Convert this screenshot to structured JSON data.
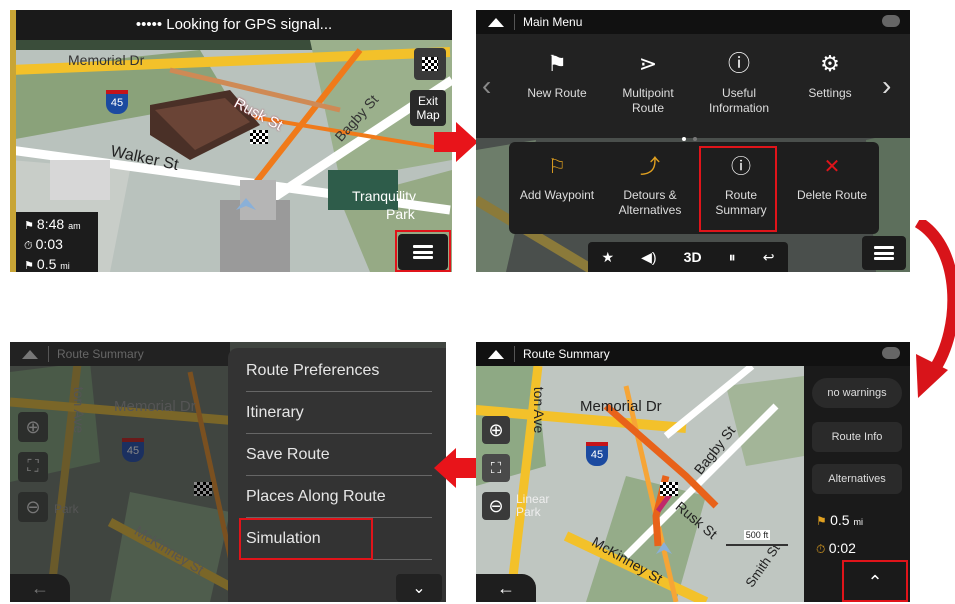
{
  "panel1": {
    "gps_status": "••••• Looking for GPS signal...",
    "street_labels": {
      "memorial": "Memorial Dr",
      "interstate": "45",
      "rusk": "Rusk St",
      "bagby": "Bagby St",
      "walker": "Walker St",
      "tranquility": "Tranquility",
      "park": "Park"
    },
    "exit_map": [
      "Exit",
      "Map"
    ],
    "stats": {
      "eta": "8:48",
      "eta_unit": "am",
      "time": "0:03",
      "distance": "0.5",
      "distance_unit": "mi"
    }
  },
  "panel2": {
    "title": "Main Menu",
    "menu_items": [
      {
        "icon": "checkered-flag",
        "label": "New Route"
      },
      {
        "icon": "multipoint",
        "label": "Multipoint\nRoute"
      },
      {
        "icon": "info",
        "label": "Useful\nInformation"
      },
      {
        "icon": "gear",
        "label": "Settings"
      }
    ],
    "sub_items": [
      {
        "icon": "waypoint-flag",
        "label": "Add Waypoint"
      },
      {
        "icon": "detour",
        "label": "Detours &\nAlternatives"
      },
      {
        "icon": "route-summary",
        "label": "Route\nSummary"
      },
      {
        "icon": "delete-route",
        "label": "Delete Route"
      }
    ],
    "bottom_bar": {
      "mode_3d": "3D"
    }
  },
  "panel3": {
    "title": "Route Summary",
    "map_labels": {
      "memorial": "Memorial Dr",
      "ave": "ton Ave",
      "interstate": "45",
      "mckinney": "McKinney St",
      "park": "Park"
    },
    "menu_items": [
      "Route Preferences",
      "Itinerary",
      "Save Route",
      "Places Along Route",
      "Simulation"
    ]
  },
  "panel4": {
    "title": "Route Summary",
    "map_labels": {
      "memorial": "Memorial Dr",
      "ave": "ton Ave",
      "interstate": "45",
      "bagby": "Bagby St",
      "rusk": "Rusk St",
      "mckinney": "McKinney St",
      "smith": "Smith St",
      "linear": "Linear",
      "park": "Park",
      "scale": "500 ft"
    },
    "side_buttons": [
      "no warnings",
      "Route Info",
      "Alternatives"
    ],
    "distance": "0.5",
    "distance_unit": "mi",
    "time": "0:02"
  },
  "colors": {
    "highlight": "#e0141a",
    "route": "#f07a1a",
    "arrow": "#e8141a"
  }
}
